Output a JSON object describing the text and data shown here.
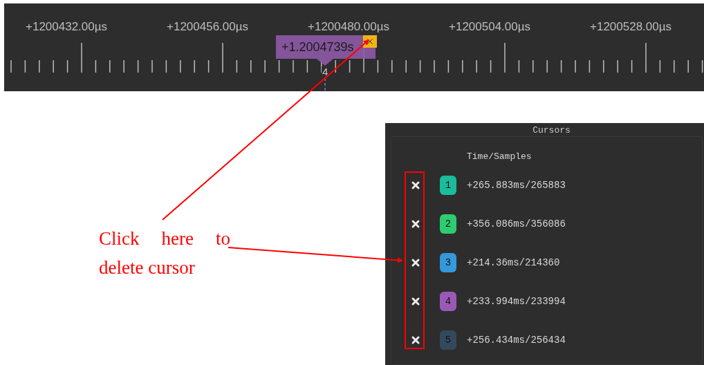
{
  "ruler": {
    "labels": [
      "+1200432.00µs",
      "+1200456.00µs",
      "+1200480.00µs",
      "+1200504.00µs",
      "+1200528.00µs"
    ]
  },
  "cursor_flag": {
    "time": "+1.2004739s",
    "number": "4",
    "color": "#8e5aa6"
  },
  "annotation": {
    "text": "Click here to delete cursor"
  },
  "cursors_panel": {
    "title": "Cursors",
    "column_header": "Time/Samples",
    "rows": [
      {
        "number": "1",
        "color": "#1abc9c",
        "value": "+265.883ms/265883"
      },
      {
        "number": "2",
        "color": "#2ecc71",
        "value": "+356.086ms/356086"
      },
      {
        "number": "3",
        "color": "#3498db",
        "value": "+214.36ms/214360"
      },
      {
        "number": "4",
        "color": "#9b59b6",
        "value": "+233.994ms/233994"
      },
      {
        "number": "5",
        "color": "#34495e",
        "value": "+256.434ms/256434"
      }
    ]
  }
}
